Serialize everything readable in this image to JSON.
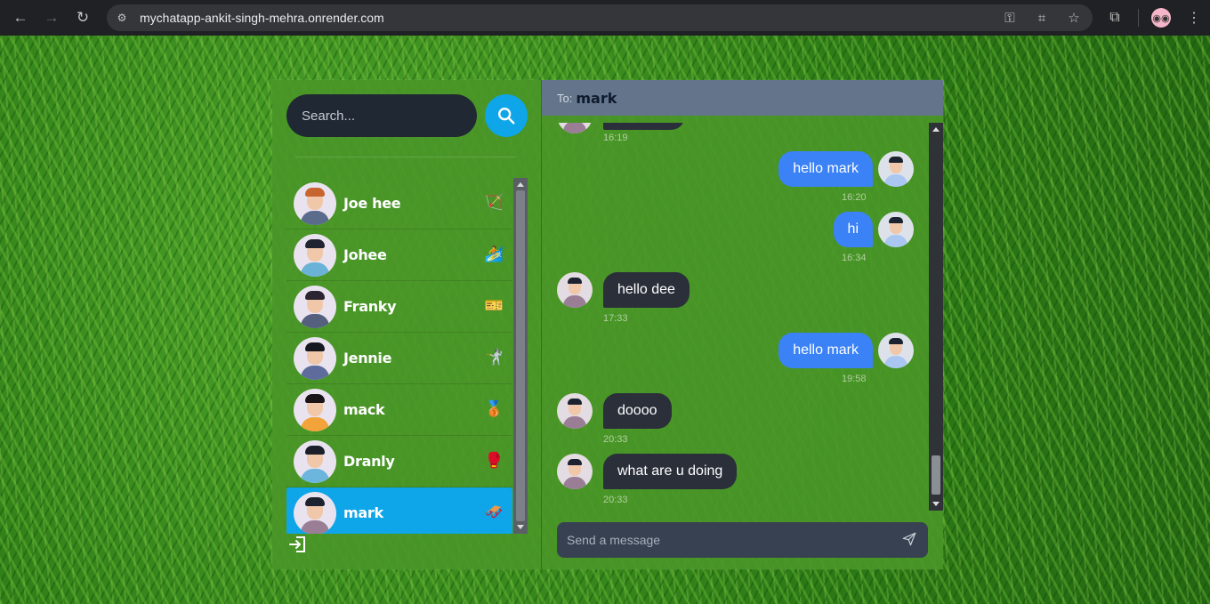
{
  "browser": {
    "url": "mychatapp-ankit-singh-mehra.onrender.com"
  },
  "sidebar": {
    "search_placeholder": "Search...",
    "contacts": [
      {
        "name": "Joe hee",
        "emoji": "🏹",
        "hair": "#c8642f",
        "body": "#5b6b8c"
      },
      {
        "name": "Johee",
        "emoji": "🏄",
        "hair": "#1f2430",
        "body": "#6bb3d6"
      },
      {
        "name": "Franky",
        "emoji": "🎫",
        "hair": "#2a2530",
        "body": "#54607e"
      },
      {
        "name": "Jennie",
        "emoji": "🤺",
        "hair": "#151820",
        "body": "#5d6c9c"
      },
      {
        "name": "mack",
        "emoji": "🥉",
        "hair": "#1a1418",
        "body": "#f2a33a"
      },
      {
        "name": "Dranly",
        "emoji": "🥊",
        "hair": "#1a1f2a",
        "body": "#6cb6de"
      },
      {
        "name": "mark",
        "emoji": "🛷",
        "hair": "#1c2230",
        "body": "#9a7e96"
      }
    ]
  },
  "chat": {
    "to_label": "To:",
    "to_name": "mark",
    "messages": [
      {
        "side": "theirs",
        "text": "",
        "time": "16:19"
      },
      {
        "side": "mine",
        "text": "hello mark",
        "time": "16:20"
      },
      {
        "side": "mine",
        "text": "hi",
        "time": "16:34"
      },
      {
        "side": "theirs",
        "text": "hello dee",
        "time": "17:33"
      },
      {
        "side": "mine",
        "text": "hello mark",
        "time": "19:58"
      },
      {
        "side": "theirs",
        "text": "doooo",
        "time": "20:33"
      },
      {
        "side": "theirs",
        "text": "what are u doing",
        "time": "20:33"
      }
    ],
    "input_placeholder": "Send a message"
  }
}
